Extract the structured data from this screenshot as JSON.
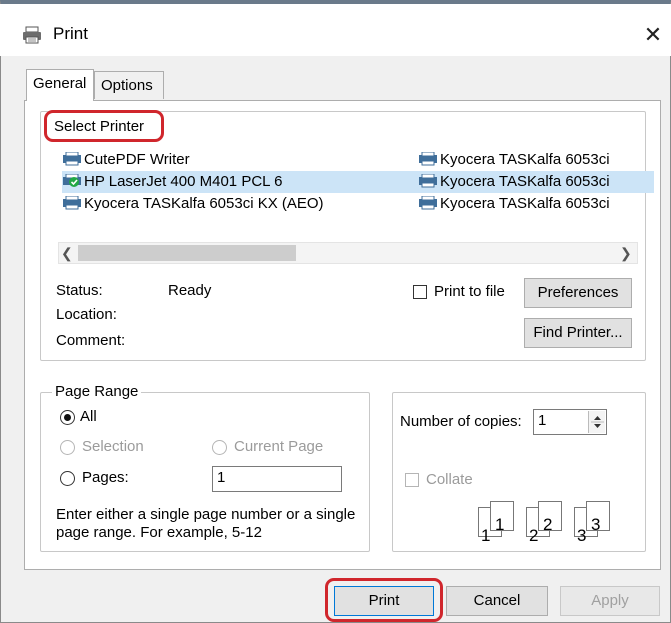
{
  "window": {
    "title": "Print"
  },
  "tabs": [
    {
      "label": "General"
    },
    {
      "label": "Options"
    }
  ],
  "select_printer": {
    "label": "Select Printer",
    "printers_col1": [
      {
        "name": "CutePDF Writer",
        "selected": false,
        "default": false
      },
      {
        "name": "HP LaserJet 400 M401 PCL 6",
        "selected": true,
        "default": true
      },
      {
        "name": "Kyocera TASKalfa 6053ci KX (AEO)",
        "selected": false,
        "default": false
      }
    ],
    "printers_col2": [
      {
        "name": "Kyocera TASKalfa 6053ci"
      },
      {
        "name": "Kyocera TASKalfa 6053ci"
      },
      {
        "name": "Kyocera TASKalfa 6053ci"
      }
    ],
    "status_label": "Status:",
    "status_value": "Ready",
    "location_label": "Location:",
    "comment_label": "Comment:",
    "print_to_file_label": "Print to file",
    "preferences_label": "Preferences",
    "find_printer_label": "Find Printer..."
  },
  "page_range": {
    "title": "Page Range",
    "all_label": "All",
    "selection_label": "Selection",
    "current_page_label": "Current Page",
    "pages_label": "Pages:",
    "pages_value": "1",
    "hint": "Enter either a single page number or a single page range.  For example, 5-12",
    "selected": "All"
  },
  "copies": {
    "label": "Number of copies:",
    "value": "1",
    "collate_label": "Collate",
    "collate_pages": [
      "1",
      "1",
      "2",
      "2",
      "3",
      "3"
    ]
  },
  "footer": {
    "print_label": "Print",
    "cancel_label": "Cancel",
    "apply_label": "Apply"
  },
  "colors": {
    "highlight": "#d0262c",
    "selection": "#cce4f7",
    "focus_border": "#0078d7"
  }
}
